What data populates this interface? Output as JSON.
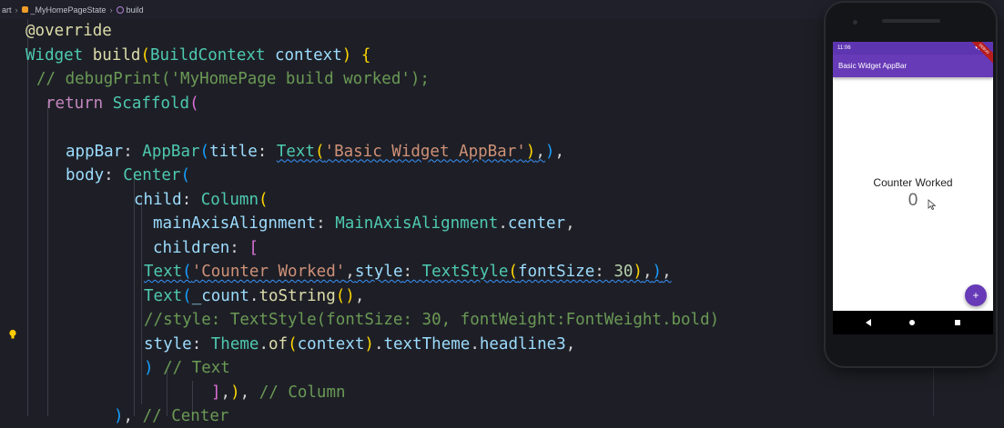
{
  "breadcrumb": {
    "items": [
      "art",
      "_MyHomePageState",
      "build"
    ]
  },
  "editor": {
    "lines": [
      [
        [
          "fn",
          "@override"
        ]
      ],
      [
        [
          "typ",
          "Widget"
        ],
        [
          "pun",
          " "
        ],
        [
          "fn",
          "build"
        ],
        [
          "brk1",
          "("
        ],
        [
          "typ",
          "BuildContext"
        ],
        [
          "pun",
          " "
        ],
        [
          "prm",
          "context"
        ],
        [
          "brk1",
          ")"
        ],
        [
          "pun",
          " "
        ],
        [
          "brk1",
          "{"
        ]
      ],
      [
        [
          "cmt",
          "// debugPrint('MyHomePage build worked');"
        ]
      ],
      [
        [
          "kw",
          "return"
        ],
        [
          "pun",
          " "
        ],
        [
          "typ",
          "Scaffold"
        ],
        [
          "brk2",
          "("
        ]
      ],
      [],
      [
        [
          "prm",
          "appBar"
        ],
        [
          "pun",
          ": "
        ],
        [
          "typ",
          "AppBar"
        ],
        [
          "brk3",
          "("
        ],
        [
          "prm",
          "title"
        ],
        [
          "pun",
          ": "
        ],
        [
          "typ",
          "Text"
        ],
        [
          "brk1",
          "("
        ],
        [
          "str",
          "'Basic Widget AppBar'"
        ],
        [
          "brk1",
          ")"
        ],
        [
          "pun",
          ","
        ],
        [
          "brk3",
          ")"
        ],
        [
          "pun",
          ","
        ]
      ],
      [
        [
          "prm",
          "body"
        ],
        [
          "pun",
          ": "
        ],
        [
          "typ",
          "Center"
        ],
        [
          "brk3",
          "("
        ]
      ],
      [
        [
          "prm",
          "child"
        ],
        [
          "pun",
          ": "
        ],
        [
          "typ",
          "Column"
        ],
        [
          "brk1",
          "("
        ]
      ],
      [
        [
          "prm",
          "mainAxisAlignment"
        ],
        [
          "pun",
          ": "
        ],
        [
          "typ",
          "MainAxisAlignment"
        ],
        [
          "pun",
          "."
        ],
        [
          "prm",
          "center"
        ],
        [
          "pun",
          ","
        ]
      ],
      [
        [
          "prm",
          "children"
        ],
        [
          "pun",
          ": "
        ],
        [
          "brk2",
          "["
        ]
      ],
      [
        [
          "typ",
          "Text"
        ],
        [
          "brk3",
          "("
        ],
        [
          "str",
          "'Counter Worked'"
        ],
        [
          "pun",
          ","
        ],
        [
          "prm",
          "style"
        ],
        [
          "pun",
          ": "
        ],
        [
          "typ",
          "TextStyle"
        ],
        [
          "brk1",
          "("
        ],
        [
          "prm",
          "fontSize"
        ],
        [
          "pun",
          ": "
        ],
        [
          "num",
          "30"
        ],
        [
          "brk1",
          ")"
        ],
        [
          "pun",
          ","
        ],
        [
          "brk3",
          ")"
        ],
        [
          "pun",
          ","
        ]
      ],
      [
        [
          "typ",
          "Text"
        ],
        [
          "brk3",
          "("
        ],
        [
          "prm",
          "_count"
        ],
        [
          "pun",
          "."
        ],
        [
          "fn",
          "toString"
        ],
        [
          "brk1",
          "()"
        ],
        [
          "pun",
          ","
        ]
      ],
      [
        [
          "cmt",
          "//style: TextStyle(fontSize: 30, fontWeight:FontWeight.bold)"
        ]
      ],
      [
        [
          "prm",
          "style"
        ],
        [
          "pun",
          ": "
        ],
        [
          "typ",
          "Theme"
        ],
        [
          "pun",
          "."
        ],
        [
          "fn",
          "of"
        ],
        [
          "brk1",
          "("
        ],
        [
          "prm",
          "context"
        ],
        [
          "brk1",
          ")"
        ],
        [
          "pun",
          "."
        ],
        [
          "prm",
          "textTheme"
        ],
        [
          "pun",
          "."
        ],
        [
          "prm",
          "headline3"
        ],
        [
          "pun",
          ","
        ]
      ],
      [
        [
          "brk3",
          ")"
        ],
        [
          "pun",
          " "
        ],
        [
          "cmt",
          "// Text"
        ]
      ],
      [
        [
          "brk2",
          "]"
        ],
        [
          "pun",
          ","
        ],
        [
          "brk1",
          ")"
        ],
        [
          "pun",
          ", "
        ],
        [
          "cmt",
          "// Column"
        ]
      ],
      [
        [
          "brk3",
          ")"
        ],
        [
          "pun",
          ", "
        ],
        [
          "cmt",
          "// Center"
        ]
      ]
    ]
  },
  "phone": {
    "status_time": "11:06",
    "status_icons": "▾◢",
    "appbar_title": "Basic Widget AppBar",
    "debug_banner": "DEBUG",
    "counter_label": "Counter Worked",
    "counter_value": "0",
    "fab_label": "+",
    "colors": {
      "primary": "#673ab7",
      "status": "#5e35b1"
    }
  }
}
